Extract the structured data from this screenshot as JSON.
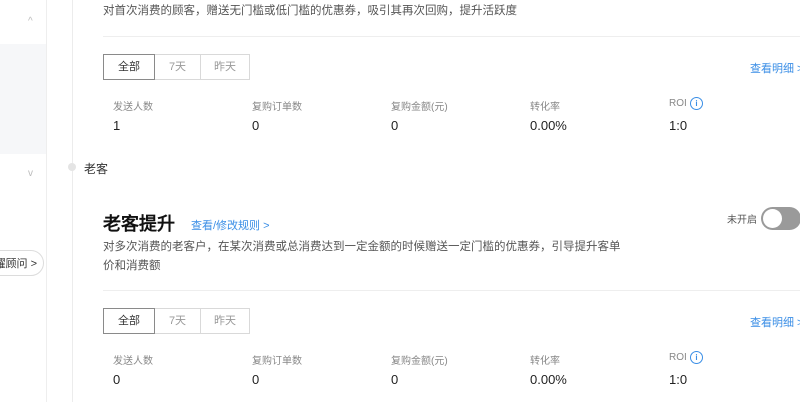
{
  "sidebar": {
    "chevron_up": "^",
    "chevron_down": "v",
    "pill_label": "耀顾问 >"
  },
  "timeline": {
    "label": "老客"
  },
  "first_section": {
    "description": "对首次消费的顾客，赠送无门槛或低门槛的优惠券，吸引其再次回购，提升活跃度",
    "tabs": [
      "全部",
      "7天",
      "昨天"
    ],
    "active_tab": "全部",
    "detail_link": "查看明细 >",
    "metrics": [
      {
        "label": "发送人数",
        "value": "1"
      },
      {
        "label": "复购订单数",
        "value": "0"
      },
      {
        "label": "复购金额(元)",
        "value": "0"
      },
      {
        "label": "转化率",
        "value": "0.00%"
      },
      {
        "label": "ROI",
        "value": "1:0"
      }
    ]
  },
  "second_section": {
    "title": "老客提升",
    "rule_link": "查看/修改规则 >",
    "toggle_label": "未开启",
    "toggle_on": false,
    "description_line1": "对多次消费的老客户，在某次消费或总消费达到一定金额的时候赠送一定门槛的优惠券，引导提升客单",
    "description_line2": "价和消费额",
    "tabs": [
      "全部",
      "7天",
      "昨天"
    ],
    "active_tab": "全部",
    "detail_link": "查看明细 >",
    "metrics": [
      {
        "label": "发送人数",
        "value": "0"
      },
      {
        "label": "复购订单数",
        "value": "0"
      },
      {
        "label": "复购金额(元)",
        "value": "0"
      },
      {
        "label": "转化率",
        "value": "0.00%"
      },
      {
        "label": "ROI",
        "value": "1:0"
      }
    ]
  },
  "icons": {
    "info": "i"
  }
}
